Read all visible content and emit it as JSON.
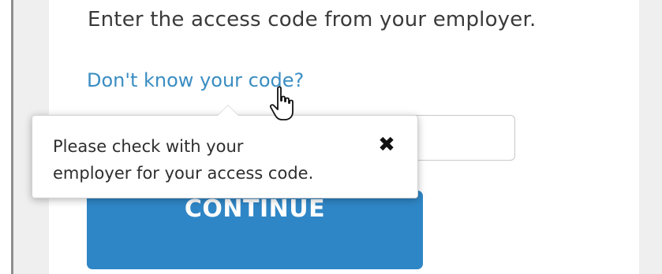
{
  "form": {
    "instruction": "Enter the access code from your employer.",
    "help_link": "Don't know your code?",
    "access_code_value": "",
    "continue_label": "CONTINUE"
  },
  "tooltip": {
    "line1": "Please check with your",
    "line2": "employer for your access code.",
    "close_icon": "close-icon"
  },
  "cursor": {
    "icon": "hand-pointer-icon"
  },
  "colors": {
    "link": "#3a8dc2",
    "button": "#2f86c6",
    "page_side": "#efefef"
  }
}
